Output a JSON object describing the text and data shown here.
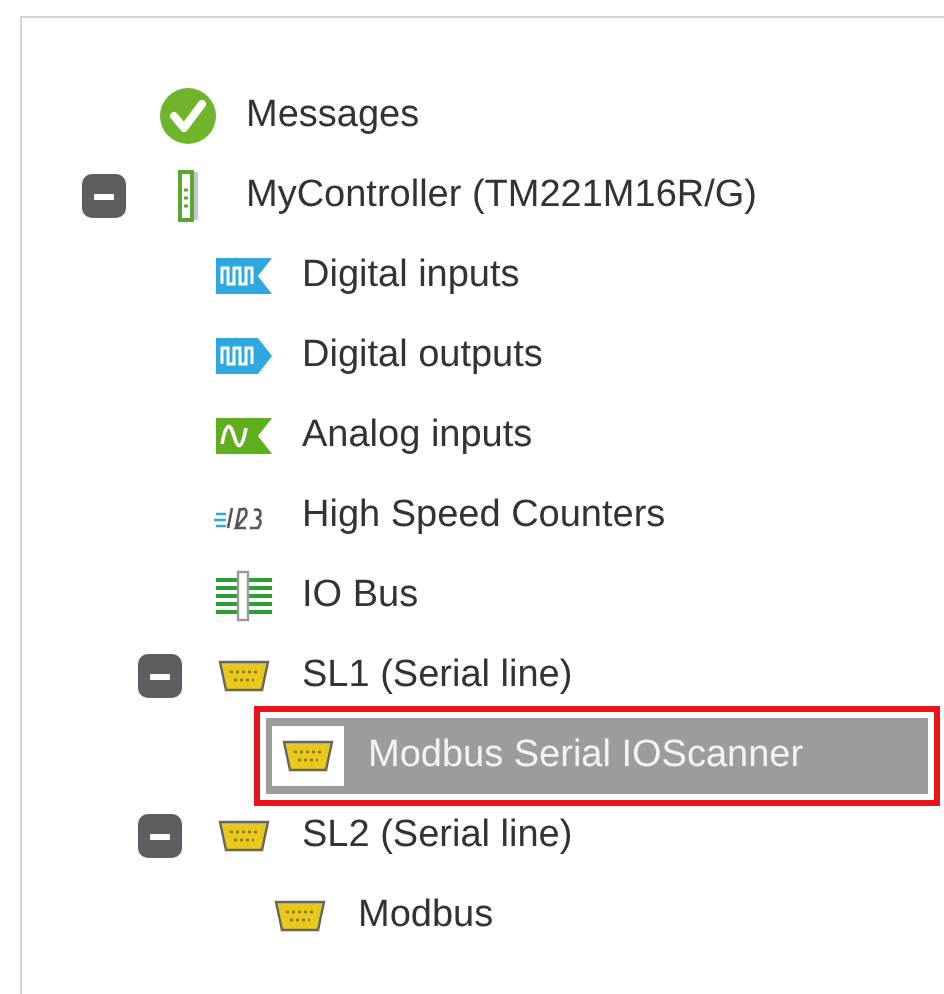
{
  "tree": [
    {
      "label": "Messages",
      "kind": "check",
      "selected": false,
      "highlighted": false
    },
    {
      "label": "MyController (TM221M16R/G)",
      "kind": "controller",
      "selected": false,
      "highlighted": false,
      "expanded": true,
      "children": [
        {
          "label": "Digital inputs",
          "kind": "digital-in",
          "selected": false,
          "highlighted": false
        },
        {
          "label": "Digital outputs",
          "kind": "digital-out",
          "selected": false,
          "highlighted": false
        },
        {
          "label": "Analog inputs",
          "kind": "analog",
          "selected": false,
          "highlighted": false
        },
        {
          "label": "High Speed Counters",
          "kind": "counter",
          "selected": false,
          "highlighted": false
        },
        {
          "label": "IO Bus",
          "kind": "bus",
          "selected": false,
          "highlighted": false
        },
        {
          "label": "SL1 (Serial line)",
          "kind": "serial",
          "selected": false,
          "highlighted": false,
          "expanded": true,
          "children": [
            {
              "label": "Modbus Serial IOScanner",
              "kind": "serial",
              "selected": true,
              "highlighted": true
            }
          ]
        },
        {
          "label": "SL2 (Serial line)",
          "kind": "serial",
          "selected": false,
          "highlighted": false,
          "expanded": true,
          "children": [
            {
              "label": "Modbus",
              "kind": "serial",
              "selected": false,
              "highlighted": false
            }
          ]
        }
      ]
    }
  ]
}
